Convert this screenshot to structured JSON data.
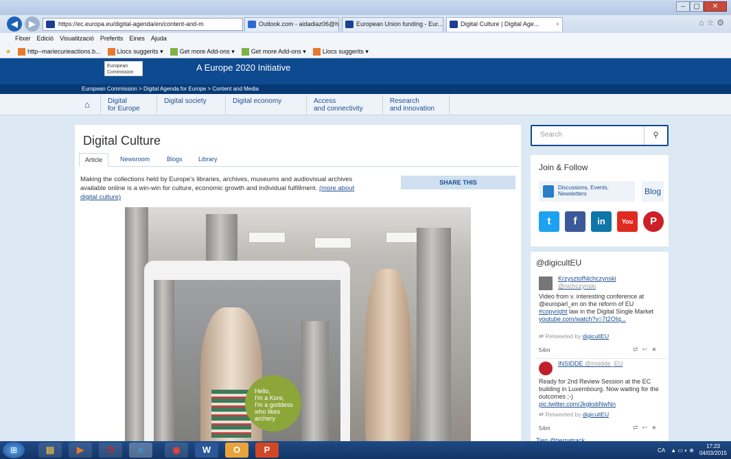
{
  "browser": {
    "url": "https://ec.europa.eu/digital-agenda/en/content-and-m",
    "nav_icons": {
      "back": "back-arrow-icon",
      "forward": "forward-arrow-icon"
    },
    "window_controls": [
      "–",
      "▢",
      "✕"
    ],
    "tabs": [
      {
        "label": "Outlook.com - aidadiaz06@ho...",
        "icon": "outlook-icon"
      },
      {
        "label": "European Union funding - Eur...",
        "icon": "eu-flag-icon"
      },
      {
        "label": "Digital Culture | Digital Age...",
        "icon": "eu-flag-icon",
        "active": true
      }
    ],
    "menu": [
      "Fitxer",
      "Edició",
      "Visualització",
      "Preferits",
      "Eines",
      "Ajuda"
    ],
    "favorites": [
      "http--mariecurieactions.b...",
      "Llocs suggerits ▾",
      "Get more Add-ons ▾",
      "Get more Add-ons ▾",
      "Llocs suggerits ▾"
    ]
  },
  "header": {
    "logo_text": "European Commission",
    "tagline": "A Europe 2020 Initiative",
    "breadcrumb": "European Commission > Digital Agenda for Europe > Content and Media"
  },
  "nav": {
    "home_icon": "home-icon",
    "items": [
      {
        "l1": "Digital",
        "l2": "for Europe"
      },
      {
        "l1": "Digital society",
        "l2": ""
      },
      {
        "l1": "Digital economy",
        "l2": ""
      },
      {
        "l1": "Access",
        "l2": "and connectivity"
      },
      {
        "l1": "Research",
        "l2": "and innovation"
      }
    ]
  },
  "article": {
    "title": "Digital Culture",
    "tabs": [
      "Article",
      "Newsroom",
      "Blogs",
      "Library"
    ],
    "intro": "Making the collections held by Europe's libraries, archives, museums and audiovisual archives available online is a win-win for culture, economic growth and individual fulfillment.",
    "intro_link": "(more about digital culture)",
    "share": "SHARE THIS",
    "bubble": [
      "Hello,",
      "I'm a Kore,",
      "I'm a goddess",
      "who likes",
      "archery"
    ]
  },
  "sidebar": {
    "search_placeholder": "Search",
    "join_title": "Join & Follow",
    "discussions": "Discussions, Events, Newsletters",
    "blog": "Blog",
    "social": [
      {
        "name": "twitter",
        "glyph": "t",
        "color": "#1da1f2"
      },
      {
        "name": "facebook",
        "glyph": "f",
        "color": "#3b5998"
      },
      {
        "name": "linkedin",
        "glyph": "in",
        "color": "#0e76a8"
      },
      {
        "name": "youtube",
        "glyph": "You",
        "color": "#e02a20"
      },
      {
        "name": "pinterest",
        "glyph": "P",
        "color": "#cb2027"
      }
    ],
    "twitter_title": "@digicultEU",
    "tweets": [
      {
        "user": "KrzysztofNichczynski",
        "handle": "@nichczynski",
        "text": "Video from v. interesting conference at @europarl_en on the reform of EU",
        "hashtag": "#copyright",
        "text2": "law in the Digital Single Market",
        "link": "youtube.com/watch?v=7t2OIq...",
        "retweeted": "Retweeted by",
        "retweeter": "digicultEU",
        "time": "54m"
      },
      {
        "user": "INSIDDE",
        "handle": "@insidde_EU",
        "text": "Ready for 2nd Review Session at the EC building in Luxembourg. Now waiting for the outcomes ;-)",
        "link": "pic.twitter.com/JkgksbNwNn",
        "retweeted": "Retweeted by",
        "retweeter": "digicultEU",
        "time": "54m"
      }
    ],
    "tweet3_partial": "Tien @tiernatrack"
  },
  "taskbar": {
    "apps": [
      {
        "name": "explorer",
        "glyph": "▤",
        "color": "#e0b34a"
      },
      {
        "name": "media",
        "glyph": "▶",
        "color": "#e8792b"
      },
      {
        "name": "opera",
        "glyph": "O",
        "color": "#d6201f"
      },
      {
        "name": "internet-explorer",
        "glyph": "e",
        "color": "#3a9ad9"
      },
      {
        "name": "chrome",
        "glyph": "◉",
        "color": "#e94335"
      },
      {
        "name": "word",
        "glyph": "W",
        "color": "#2b5797"
      },
      {
        "name": "outlook",
        "glyph": "O",
        "color": "#e8a33a"
      },
      {
        "name": "powerpoint",
        "glyph": "P",
        "color": "#d24726"
      }
    ],
    "lang": "CA",
    "time": "17:23",
    "date": "04/03/2015"
  }
}
